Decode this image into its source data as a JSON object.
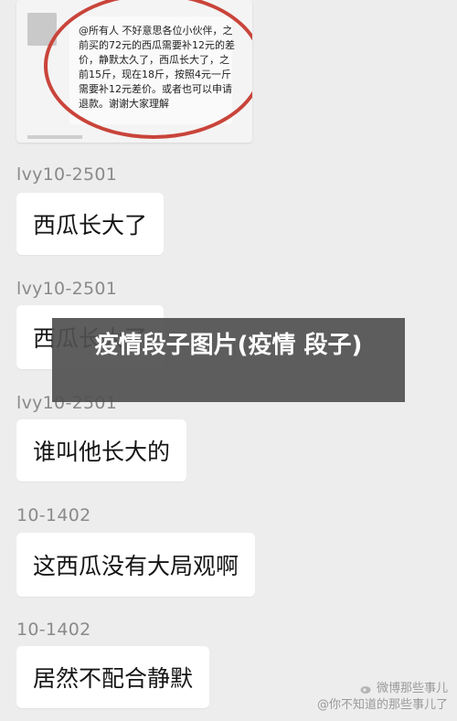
{
  "quoted_message": {
    "text": "@所有人 不好意思各位小伙伴，之前买的72元的西瓜需要补12元的差价，静默太久了，西瓜长大了，之前15斤，现在18斤，按照4元一斤需要补12元差价。或者也可以申请退款。谢谢大家理解"
  },
  "messages": [
    {
      "sender": "lvy10-2501",
      "text": "西瓜长大了"
    },
    {
      "sender": "lvy10-2501",
      "text": "西瓜长大了"
    },
    {
      "sender": "lvy10-2501",
      "text": "谁叫他长大的"
    },
    {
      "sender": "10-1402",
      "text": "这西瓜没有大局观啊"
    },
    {
      "sender": "10-1402",
      "text": "居然不配合静默"
    }
  ],
  "overlay": {
    "title": "疫情段子图片(疫情 段子)"
  },
  "watermark": {
    "line1": "微博那些事儿",
    "line2": "@你不知道的那些事儿了"
  }
}
